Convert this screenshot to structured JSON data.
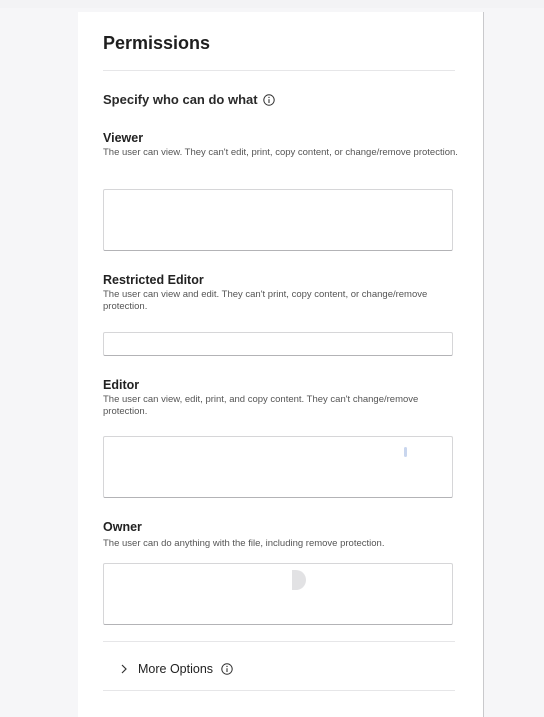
{
  "panel": {
    "title": "Permissions",
    "subtitle": "Specify who can do what",
    "roles": [
      {
        "label": "Viewer",
        "description": "The user can view. They can't edit, print, copy content, or change/remove protection.",
        "input_value": ""
      },
      {
        "label": "Restricted Editor",
        "description": "The user can view and edit. They can't print, copy content, or change/remove protection.",
        "input_value": ""
      },
      {
        "label": "Editor",
        "description": "The user can view, edit, print, and copy content. They can't change/remove protection.",
        "input_value": ""
      },
      {
        "label": "Owner",
        "description": "The user can do anything with the file, including remove protection.",
        "input_value": ""
      }
    ],
    "more_options_label": "More Options"
  },
  "icons": {
    "subtitle_info": "info-icon",
    "more_options_chevron": "chevron-right-icon",
    "more_options_info": "info-icon"
  },
  "colors": {
    "panel_bg": "#ffffff",
    "page_bg": "#f6f6f8",
    "text": "#222222",
    "muted_text": "#555555",
    "field_border": "#d6d6d8"
  }
}
